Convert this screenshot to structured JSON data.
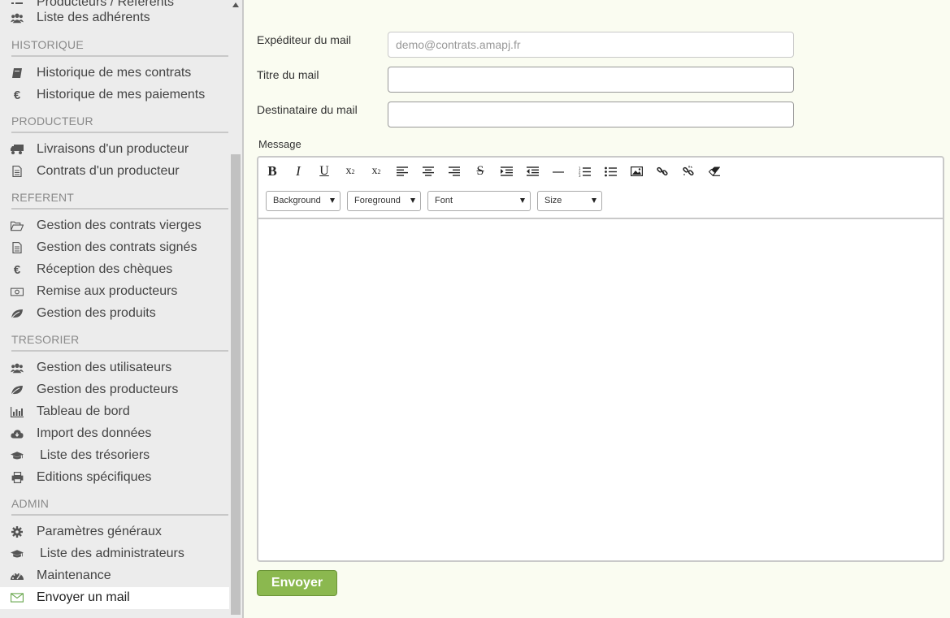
{
  "sidebar": {
    "items": [
      {
        "label": "Producteurs / Référents",
        "icon": "list-icon"
      },
      {
        "label": "Liste des adhérents",
        "icon": "users-icon"
      }
    ],
    "sections": [
      {
        "title": "HISTORIQUE",
        "items": [
          {
            "label": "Historique de mes contrats",
            "icon": "book-icon"
          },
          {
            "label": "Historique de mes paiements",
            "icon": "euro-icon"
          }
        ]
      },
      {
        "title": "PRODUCTEUR",
        "items": [
          {
            "label": "Livraisons d'un producteur",
            "icon": "truck-icon"
          },
          {
            "label": "Contrats d'un producteur",
            "icon": "document-icon"
          }
        ]
      },
      {
        "title": "REFERENT",
        "items": [
          {
            "label": "Gestion des contrats vierges",
            "icon": "folder-open-icon"
          },
          {
            "label": "Gestion des contrats signés",
            "icon": "document-icon"
          },
          {
            "label": "Réception des chèques",
            "icon": "euro-icon"
          },
          {
            "label": "Remise aux producteurs",
            "icon": "money-icon"
          },
          {
            "label": "Gestion des produits",
            "icon": "leaf-icon"
          }
        ]
      },
      {
        "title": "TRESORIER",
        "items": [
          {
            "label": "Gestion des utilisateurs",
            "icon": "users-icon"
          },
          {
            "label": "Gestion des producteurs",
            "icon": "leaf-icon"
          },
          {
            "label": "Tableau de bord",
            "icon": "bar-chart-icon"
          },
          {
            "label": "Import des données",
            "icon": "cloud-download-icon"
          },
          {
            "label": "Liste des trésoriers",
            "icon": "graduation-cap-icon"
          },
          {
            "label": "Editions spécifiques",
            "icon": "print-icon"
          }
        ]
      },
      {
        "title": "ADMIN",
        "items": [
          {
            "label": "Paramètres généraux",
            "icon": "gear-icon"
          },
          {
            "label": "Liste des administrateurs",
            "icon": "graduation-cap-icon"
          },
          {
            "label": "Maintenance",
            "icon": "dashboard-icon"
          },
          {
            "label": "Envoyer un mail",
            "icon": "envelope-icon",
            "active": true
          }
        ]
      }
    ]
  },
  "form": {
    "sender_label": "Expéditeur du mail",
    "sender_value": "demo@contrats.amapj.fr",
    "title_label": "Titre du mail",
    "title_value": "",
    "recipient_label": "Destinataire du mail",
    "recipient_value": "",
    "message_label": "Message"
  },
  "editor": {
    "buttons": [
      "bold-icon",
      "italic-icon",
      "underline-icon",
      "subscript-icon",
      "superscript-icon",
      "align-left-icon",
      "align-center-icon",
      "align-right-icon",
      "strikethrough-icon",
      "indent-icon",
      "outdent-icon",
      "horizontal-rule-icon",
      "ordered-list-icon",
      "unordered-list-icon",
      "image-icon",
      "link-icon",
      "unlink-icon",
      "eraser-icon"
    ],
    "selects": {
      "background": "Background",
      "foreground": "Foreground",
      "font": "Font",
      "size": "Size"
    },
    "content": ""
  },
  "actions": {
    "send_label": "Envoyer"
  },
  "colors": {
    "accent_green": "#8bb84f",
    "active_icon_green": "#6aa84f",
    "sidebar_bg": "#ececec",
    "page_bg": "#fafcf1"
  }
}
